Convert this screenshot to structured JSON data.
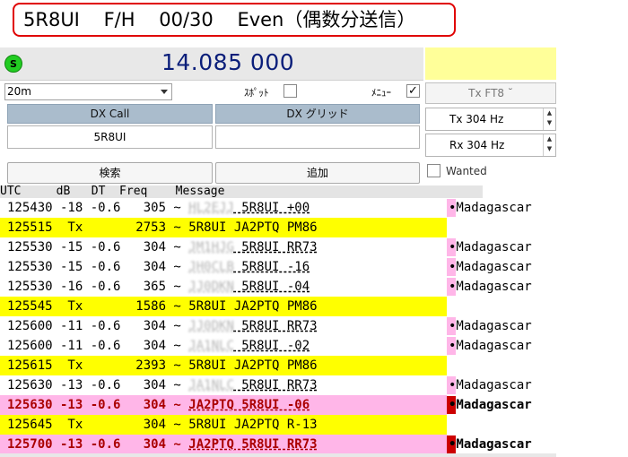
{
  "banner": {
    "text": "5R8UI    F/H    00/30    Even（偶数分送信）"
  },
  "frequency": {
    "status_label": "S",
    "value": "14.085 000"
  },
  "controls": {
    "band": "20m",
    "spot_label": "ｽﾎﾟｯﾄ",
    "menu_label": "ﾒﾆｭｰ",
    "menu_checked": "✓",
    "tx_mode": "Tx FT8 ˘"
  },
  "dx": {
    "call_header": "DX Call",
    "grid_header": "DX グリッド",
    "call_value": "5R8UI",
    "grid_value": ""
  },
  "tx_freq": {
    "label": "Tx  304  Hz"
  },
  "rx_freq": {
    "label": "Rx  304  Hz"
  },
  "buttons": {
    "search": "検索",
    "add": "追加",
    "wanted": "Wanted"
  },
  "table": {
    "header": "UTC     dB   DT  Freq    Message",
    "rows": [
      {
        "main": "125430 -18 -0.6   305 ~ ",
        "blur": "HL2EJJ",
        "msg": " 5R8UI +00",
        "country": "•Madagascar",
        "style": "white-pink"
      },
      {
        "main": "125515  Tx       2753 ~ ",
        "blur": "",
        "msg": "5R8UI JA2PTQ PM86",
        "country": "",
        "style": "yellow"
      },
      {
        "main": "125530 -15 -0.6   304 ~ ",
        "blur": "JM1HJG",
        "msg": " 5R8UI RR73",
        "country": "•Madagascar",
        "style": "white-pink"
      },
      {
        "main": "125530 -15 -0.6   304 ~ ",
        "blur": "JH0CLB",
        "msg": " 5R8UI -16",
        "country": "•Madagascar",
        "style": "white-pink"
      },
      {
        "main": "125530 -16 -0.6   365 ~ ",
        "blur": "JJ0DKN",
        "msg": " 5R8UI -04",
        "country": "•Madagascar",
        "style": "white-pink"
      },
      {
        "main": "125545  Tx       1586 ~ ",
        "blur": "",
        "msg": "5R8UI JA2PTQ PM86",
        "country": "",
        "style": "yellow"
      },
      {
        "main": "125600 -11 -0.6   304 ~ ",
        "blur": "JJ0DKN",
        "msg": " 5R8UI RR73",
        "country": "•Madagascar",
        "style": "white-pink"
      },
      {
        "main": "125600 -11 -0.6   304 ~ ",
        "blur": "JA1NLC",
        "msg": " 5R8UI -02",
        "country": "•Madagascar",
        "style": "white-pink"
      },
      {
        "main": "125615  Tx       2393 ~ ",
        "blur": "",
        "msg": "5R8UI JA2PTQ PM86",
        "country": "",
        "style": "yellow"
      },
      {
        "main": "125630 -13 -0.6   304 ~ ",
        "blur": "JA1NLC",
        "msg": " 5R8UI RR73",
        "country": "•Madagascar",
        "style": "white-pink"
      },
      {
        "main": "125630 -13 -0.6   304 ~ ",
        "blur": "",
        "msg": "JA2PTQ 5R8UI -06",
        "country": "•Madagascar",
        "style": "pink-bold"
      },
      {
        "main": "125645  Tx        304 ~ ",
        "blur": "",
        "msg": "5R8UI JA2PTQ R-13",
        "country": "",
        "style": "yellow"
      },
      {
        "main": "125700 -13 -0.6   304 ~ ",
        "blur": "",
        "msg": "JA2PTQ 5R8UI RR73",
        "country": "•Madagascar",
        "style": "pink-bold"
      }
    ]
  },
  "colors": {
    "yellow_row": "#ffff00",
    "pink_row": "#ffb6e8",
    "country_marker_pink": "#ffb6e8",
    "country_marker_red": "#cc0000",
    "bold_text": "#aa0000",
    "banner_border": "#e00000",
    "frequency_text": "#0a1e7a"
  }
}
